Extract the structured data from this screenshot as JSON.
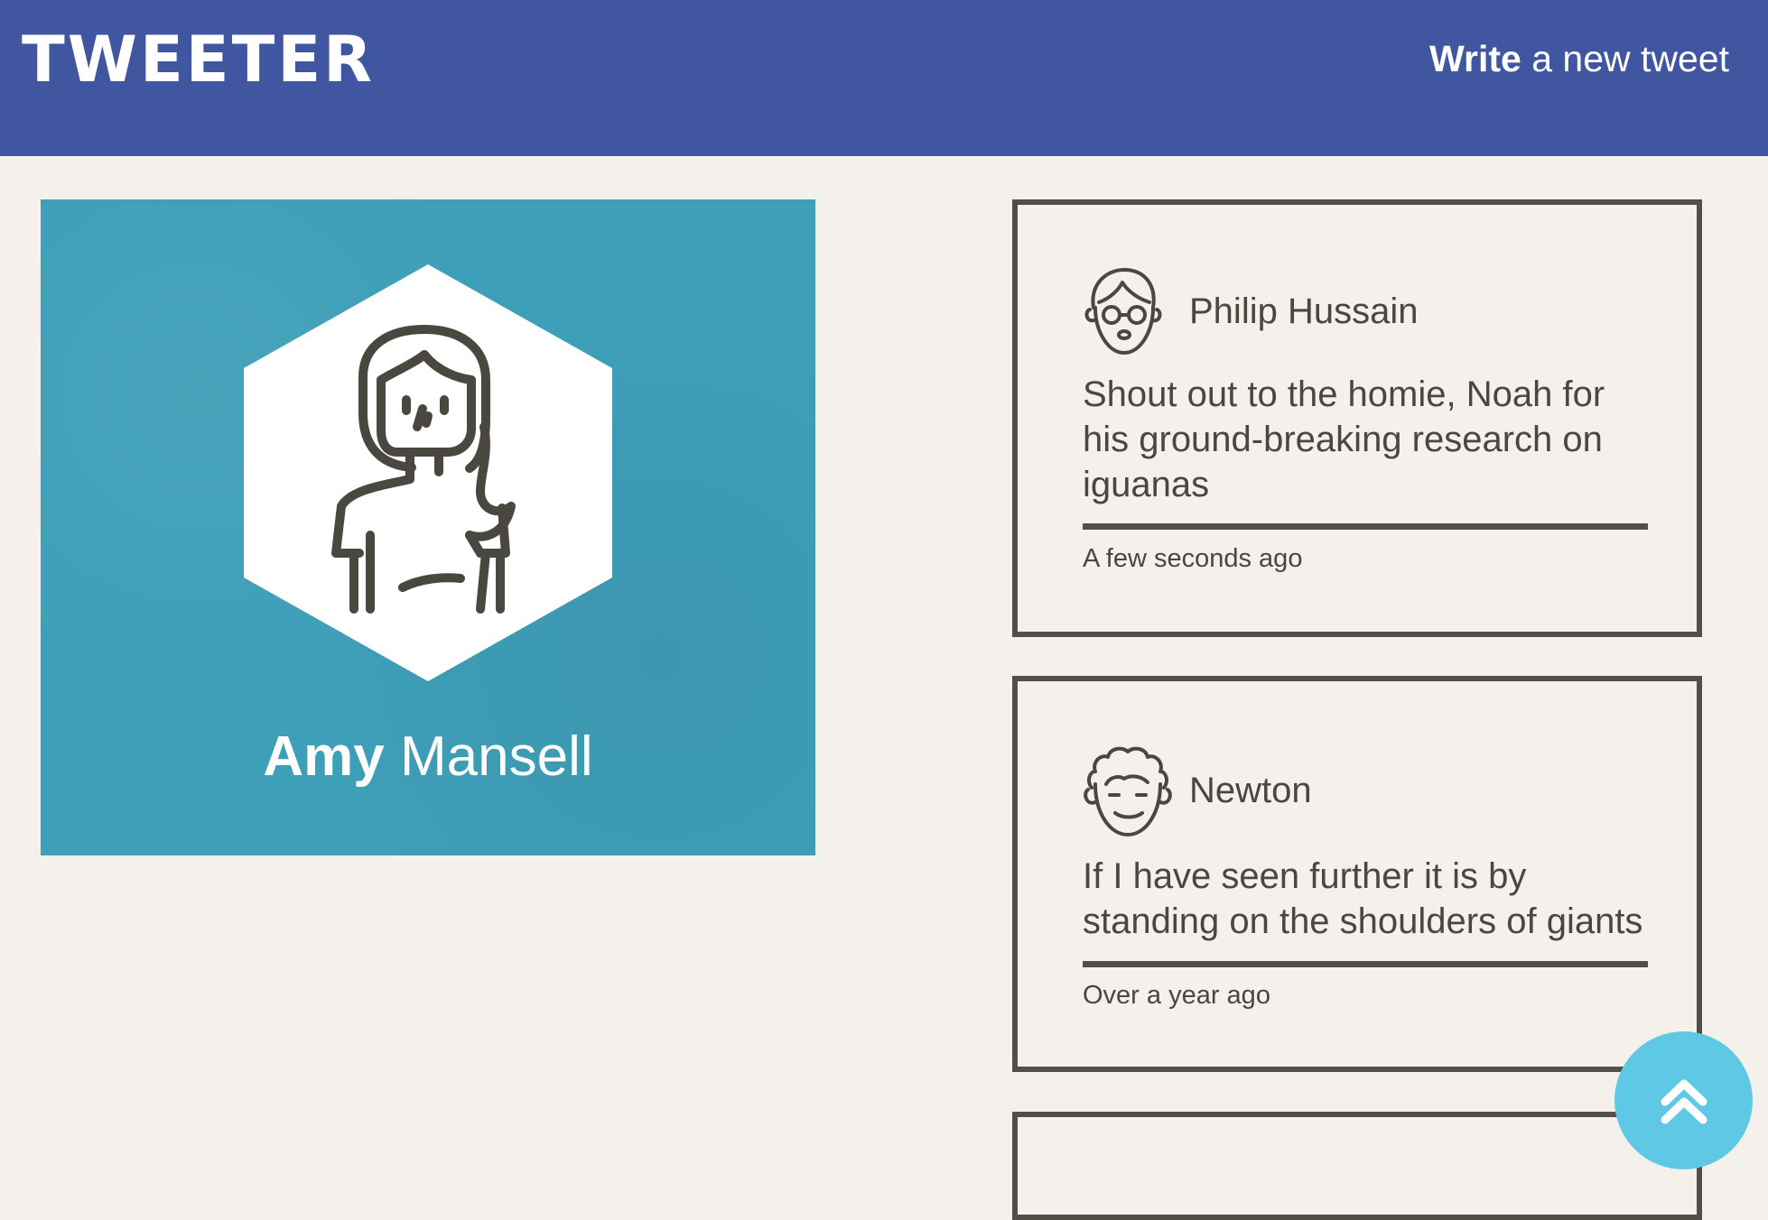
{
  "header": {
    "brand": "TWEETER",
    "compose_strong": "Write",
    "compose_rest": "a new tweet"
  },
  "profile": {
    "first_name": "Amy",
    "last_name": "Mansell",
    "avatar_icon": "woman-avatar-icon",
    "card_color": "#3e9fb8"
  },
  "tweets": [
    {
      "author": "Philip Hussain",
      "avatar_icon": "man-glasses-avatar-icon",
      "text": "Shout out to the homie, Noah for his ground-breaking research on iguanas",
      "time": "A few seconds ago"
    },
    {
      "author": "Newton",
      "avatar_icon": "curly-hair-avatar-icon",
      "text": "If I have seen further it is by standing on the shoulders of giants",
      "time": "Over a year ago"
    }
  ],
  "scroll_top": {
    "icon": "double-chevron-up-icon",
    "color": "#5ec8e5"
  },
  "theme": {
    "nav_bg": "#4056a1",
    "page_bg": "#f4f1ec",
    "border": "#524f48"
  }
}
